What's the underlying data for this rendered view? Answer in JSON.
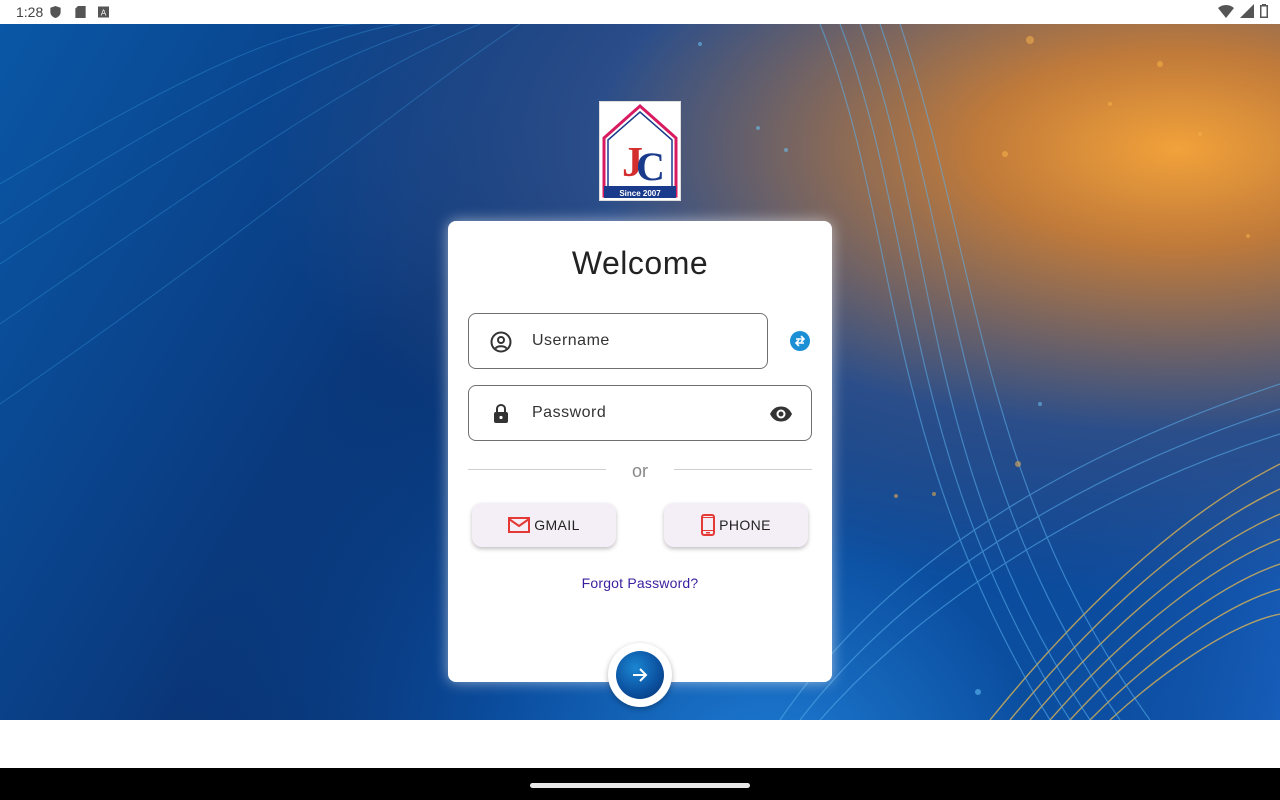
{
  "status_bar": {
    "time": "1:28"
  },
  "logo": {
    "tagline": "Since 2007"
  },
  "card": {
    "title": "Welcome",
    "username_placeholder": "Username",
    "password_placeholder": "Password",
    "divider_text": "or",
    "gmail_label": "GMAIL",
    "phone_label": "PHONE",
    "forgot_label": "Forgot Password?"
  },
  "icons": {
    "username": "account-circle-icon",
    "password": "lock-icon",
    "visibility": "eye-icon",
    "swap": "swap-icon",
    "gmail": "mail-icon",
    "phone": "smartphone-icon",
    "submit": "arrow-right-icon"
  },
  "colors": {
    "accent": "#0a4f9e",
    "link": "#3a1f9e",
    "social_icon_red": "#e53935"
  }
}
